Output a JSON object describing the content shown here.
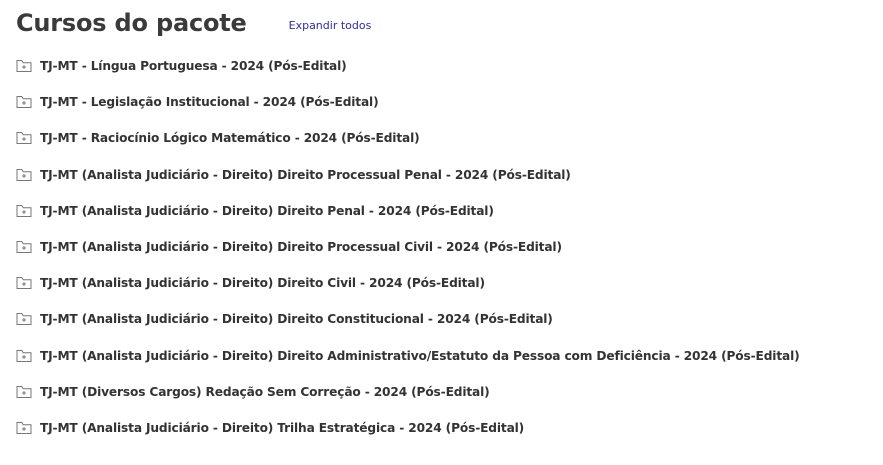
{
  "header": {
    "title": "Cursos do pacote",
    "expand_all_label": "Expandir todos"
  },
  "colors": {
    "text": "#333333",
    "link": "#2c2ca8",
    "icon": "#777777"
  },
  "courses": [
    {
      "label": "TJ-MT - Língua Portuguesa - 2024 (Pós-Edital)",
      "icon": "folder-plus-icon"
    },
    {
      "label": "TJ-MT - Legislação Institucional - 2024 (Pós-Edital)",
      "icon": "folder-plus-icon"
    },
    {
      "label": "TJ-MT - Raciocínio Lógico Matemático - 2024 (Pós-Edital)",
      "icon": "folder-plus-icon"
    },
    {
      "label": "TJ-MT (Analista Judiciário - Direito) Direito Processual Penal - 2024 (Pós-Edital)",
      "icon": "folder-plus-icon"
    },
    {
      "label": "TJ-MT (Analista Judiciário - Direito) Direito Penal - 2024 (Pós-Edital)",
      "icon": "folder-plus-icon"
    },
    {
      "label": "TJ-MT (Analista Judiciário - Direito) Direito Processual Civil - 2024 (Pós-Edital)",
      "icon": "folder-plus-icon"
    },
    {
      "label": "TJ-MT (Analista Judiciário - Direito) Direito Civil - 2024 (Pós-Edital)",
      "icon": "folder-plus-icon"
    },
    {
      "label": "TJ-MT (Analista Judiciário - Direito) Direito Constitucional - 2024 (Pós-Edital)",
      "icon": "folder-plus-icon"
    },
    {
      "label": "TJ-MT (Analista Judiciário - Direito) Direito Administrativo/Estatuto da Pessoa com Deficiência - 2024 (Pós-Edital)",
      "icon": "folder-plus-icon"
    },
    {
      "label": "TJ-MT (Diversos Cargos) Redação Sem Correção - 2024 (Pós-Edital)",
      "icon": "folder-plus-icon"
    },
    {
      "label": "TJ-MT (Analista Judiciário - Direito) Trilha Estratégica - 2024 (Pós-Edital)",
      "icon": "folder-plus-icon"
    }
  ]
}
